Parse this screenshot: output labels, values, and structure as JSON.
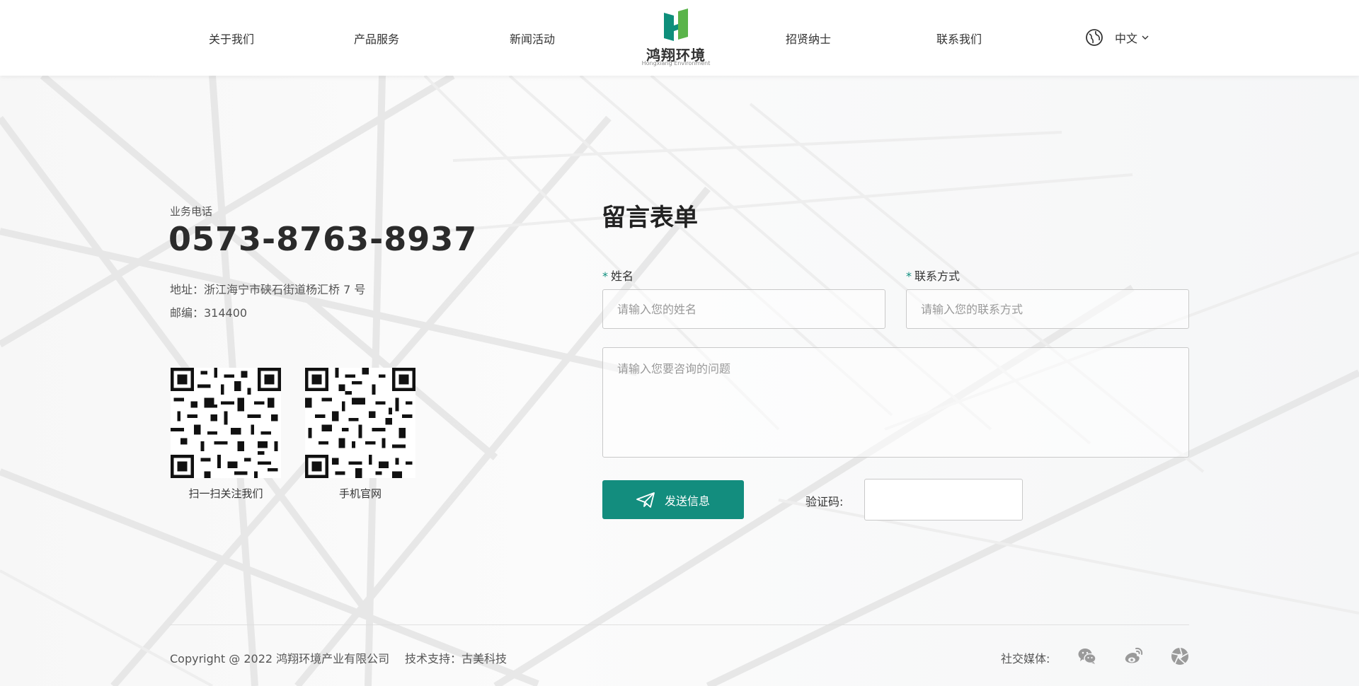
{
  "header": {
    "nav": [
      {
        "label": "关于我们"
      },
      {
        "label": "产品服务"
      },
      {
        "label": "新闻活动"
      },
      {
        "label": "招贤纳士"
      },
      {
        "label": "联系我们"
      }
    ],
    "logo": {
      "name": "鸿翔环境",
      "sub": "Hongxiang Environment"
    },
    "language": {
      "label": "中文",
      "icon": "globe-icon"
    }
  },
  "contact": {
    "phone_label": "业务电话",
    "phone": "0573-8763-8937",
    "address": "地址：浙江海宁市硖石街道杨汇桥 7 号",
    "zip": "邮编：314400",
    "qr_codes": [
      {
        "caption": "扫一扫关注我们"
      },
      {
        "caption": "手机官网"
      }
    ]
  },
  "form": {
    "title": "留言表单",
    "name_label": "姓名",
    "name_placeholder": "请输入您的姓名",
    "contact_label": "联系方式",
    "contact_placeholder": "请输入您的联系方式",
    "question_placeholder": "请输入您要咨询的问题",
    "send_label": "发送信息",
    "captcha_label": "验证码:"
  },
  "footer": {
    "copyright": "Copyright @ 2022 鸿翔环境产业有限公司",
    "tech_label": "技术支持：",
    "tech_link": "古美科技",
    "social_label": "社交媒体:",
    "social_icons": [
      "wechat-icon",
      "weibo-icon",
      "aperture-icon"
    ]
  },
  "colors": {
    "accent": "#138d7e",
    "logo_green": "#5ab44a",
    "logo_teal": "#0e8f7b"
  }
}
